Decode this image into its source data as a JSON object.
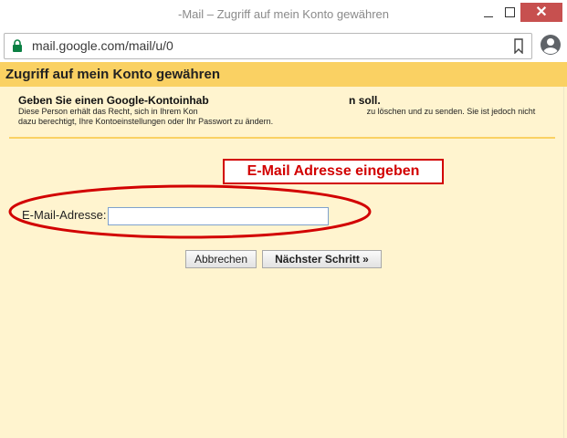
{
  "window": {
    "title": "-Mail – Zugriff auf mein Konto gewähren",
    "close_glyph": "✕"
  },
  "browser": {
    "url": "mail.google.com/mail/u/0"
  },
  "page": {
    "title": "Zugriff auf mein Konto gewähren",
    "heading": "Geben Sie einen Google-Kontoinhab                                              n soll.",
    "description": "Diese Person erhält das Recht, sich in Ihrem Kon                                                                          zu löschen und zu senden. Sie ist jedoch nicht dazu berechtigt, Ihre Kontoeinstellungen oder Ihr Passwort zu ändern.",
    "callout": "E-Mail Adresse eingeben",
    "email_label": "E-Mail-Adresse:",
    "email_value": "",
    "buttons": {
      "cancel": "Abbrechen",
      "next": "Nächster Schritt »"
    }
  },
  "colors": {
    "header": "#fad163",
    "background": "#fff4cf",
    "annotation_red": "#d20000",
    "close_button": "#c7504f"
  }
}
